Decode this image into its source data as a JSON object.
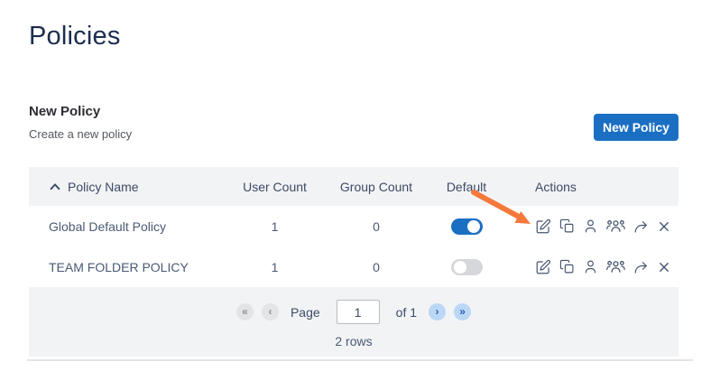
{
  "page": {
    "title": "Policies"
  },
  "section": {
    "heading": "New Policy",
    "subheading": "Create a new policy",
    "new_policy_button": "New Policy"
  },
  "table": {
    "columns": [
      "Policy Name",
      "User Count",
      "Group Count",
      "Default",
      "Actions"
    ],
    "sort": {
      "column": "Policy Name",
      "direction": "ascending",
      "icon": "chevron-up-icon"
    },
    "rows": [
      {
        "name": "Global Default Policy",
        "user_count": "1",
        "group_count": "0",
        "default_on": true
      },
      {
        "name": "TEAM FOLDER POLICY",
        "user_count": "1",
        "group_count": "0",
        "default_on": false
      }
    ],
    "action_icons": [
      "edit-icon",
      "copy-icon",
      "user-icon",
      "group-icon",
      "share-icon",
      "remove-icon"
    ]
  },
  "pagination": {
    "first_label": "«",
    "prev_label": "‹",
    "page_label": "Page",
    "page_value": "1",
    "of_label": "of 1",
    "next_label": "›",
    "last_label": "»",
    "rows_label": "2 rows"
  },
  "annotation": {
    "type": "arrow",
    "points_to": "edit-icon-row-1",
    "color": "#f4793b"
  },
  "colors": {
    "accent_blue": "#1b6fc2",
    "title_navy": "#1d2d50",
    "icon_slate": "#44536d",
    "table_band_bg": "#f2f3f5",
    "pager_enabled_bg": "#bcd7f5",
    "pager_disabled_bg": "#e3e4e6",
    "toggle_off_bg": "#d6d7da",
    "arrow_orange": "#f4793b"
  }
}
